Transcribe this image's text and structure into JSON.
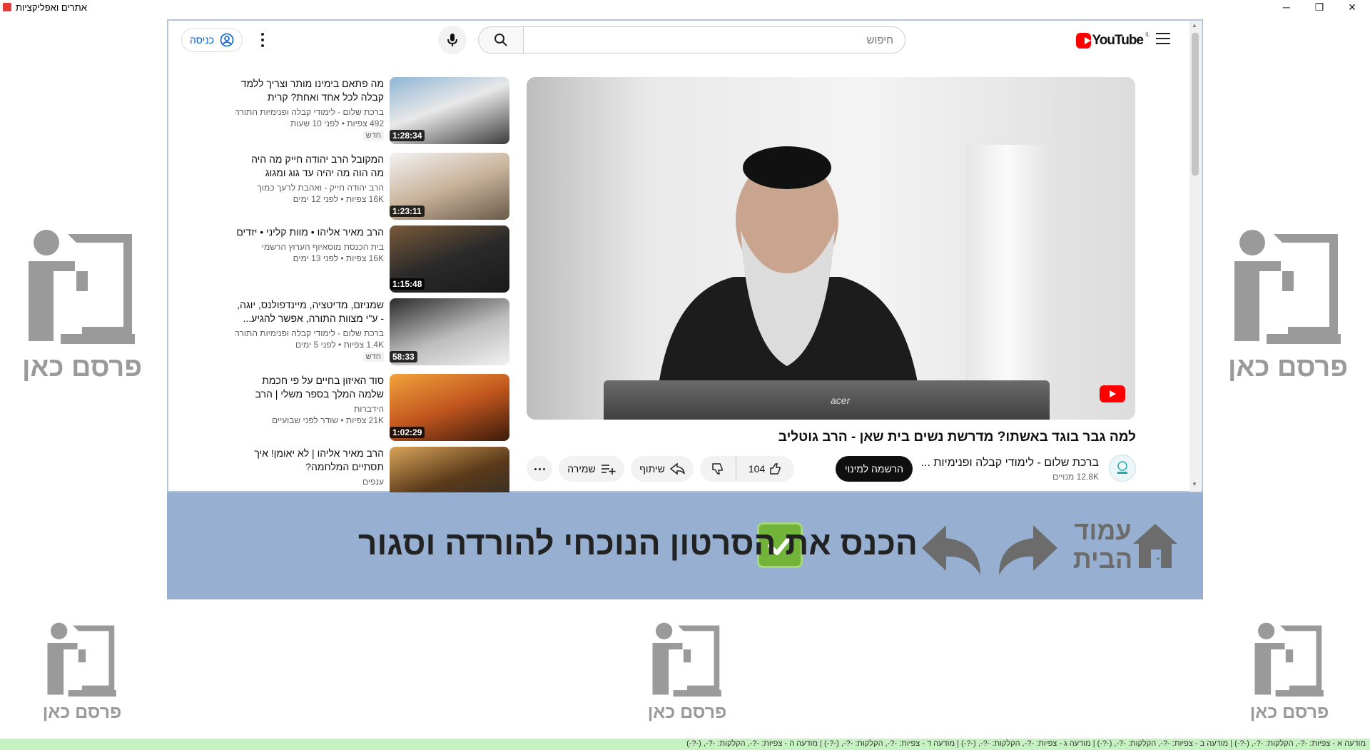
{
  "window": {
    "title": "אתרים ואפליקציות",
    "controls": {
      "minimize": "─",
      "maximize": "❐",
      "close": "✕"
    }
  },
  "youtube": {
    "logo_text": "YouTube",
    "country": "IL",
    "search_placeholder": "חיפוש",
    "signin_label": "כניסה",
    "video": {
      "title": "למה גבר בוגד באשתו? מדרשת נשים בית שאן - הרב גוטליב",
      "channel": "ברכת שלום - לימודי קבלה ופנימיות ...",
      "subscribers": "12.8K מנויים",
      "subscribe_label": "הרשמה למינוי",
      "likes": "104",
      "share_label": "שיתוף",
      "save_label": "שמירה",
      "player_brand": "acer"
    },
    "recommendations": [
      {
        "title": "מה פתאם בימינו מותר וצריך ללמד קבלה לכל אחד ואחת? קרית טבעון...",
        "channel": "ברכת שלום - לימודי קבלה ופנימיות התורה...",
        "views": "492 צפיות",
        "age": "לפני 10 שעות",
        "badge": "חדש",
        "duration": "1:28:34"
      },
      {
        "title": "המקובל הרב יהודה חייק מה היה מה הוה מה יהיה עד גוג ומגוג וביאת...",
        "channel": "הרב יהודה חייק - ואהבת לרעך כמוך",
        "views": "16K צפיות",
        "age": "לפני 12 ימים",
        "badge": "",
        "duration": "1:23:11"
      },
      {
        "title": "הרב מאיר אליהו • מוות קליני • יזדים",
        "channel": "בית הכנסת מוסאיוף הערוץ הרשמי",
        "views": "16K צפיות",
        "age": "לפני 13 ימים",
        "badge": "",
        "duration": "1:15:48"
      },
      {
        "title": "שמניזם, מדיטציה, מיינדפולנס, יוגה, - ע\"י מצוות התורה, אפשר להגיע...",
        "channel": "ברכת שלום - לימודי קבלה ופנימיות התורה...",
        "views": "1.4K צפיות",
        "age": "לפני 5 ימים",
        "badge": "חדש",
        "duration": "58:33"
      },
      {
        "title": "סוד האיזון בחיים על פי חכמת שלמה המלך בספר משלי | הרב זמיר כהן...",
        "channel": "הידברות",
        "views": "21K צפיות",
        "age": "שודר לפני שבועיים",
        "badge": "",
        "duration": "1:02:29"
      },
      {
        "title": "הרב מאיר אליהו | לא יאומן! איך תסתיים המלחמה?",
        "channel": "ענפים",
        "views": "",
        "age": "",
        "badge": "",
        "duration": ""
      }
    ]
  },
  "control_bar": {
    "home_label": "עמוד הבית",
    "message": "הכנס את הסרטון הנוכחי להורדה וסגור"
  },
  "ads": {
    "label": "פרסם כאן"
  },
  "status_ticker": "מודעה א - צפיות: -?-, הקלקות: -?-, (-?-) | מודעה ב - צפיות: -?-, הקלקות: -?-, (-?-) | מודעה ג - צפיות: -?-, הקלקות: -?-, (-?-) | מודעה ד - צפיות: -?-, הקלקות: -?-, (-?-) | מודעה ה - צפיות: -?-, הקלקות: -?-, (-?-)",
  "colors": {
    "yt_red": "#ff0000",
    "bar_blue": "#97b0d1",
    "check_green": "#72b43a",
    "status_green": "#c6f2c2",
    "ad_gray": "#9a9a9a"
  }
}
